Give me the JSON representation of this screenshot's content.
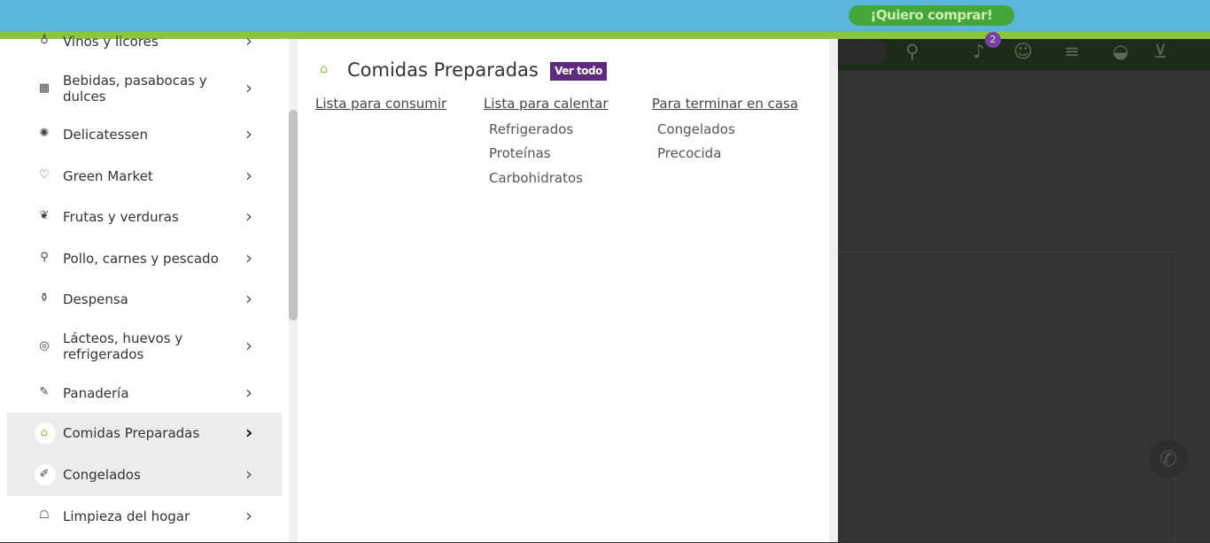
{
  "topbar": {
    "cta_label": "¡Quiero comprar!"
  },
  "header": {
    "notification_count": "2"
  },
  "sidebar": {
    "items": [
      {
        "label": "Vinos y licores",
        "icon": "wine-glass-icon"
      },
      {
        "label": "Bebidas, pasabocas y\ndulces",
        "icon": "snacks-icon"
      },
      {
        "label": "Delicatessen",
        "icon": "cookie-icon"
      },
      {
        "label": "Green Market",
        "icon": "heart-icon"
      },
      {
        "label": "Frutas y verduras",
        "icon": "fruit-icon"
      },
      {
        "label": "Pollo, carnes y pescado",
        "icon": "drumstick-icon"
      },
      {
        "label": "Despensa",
        "icon": "pantry-icon"
      },
      {
        "label": "Lácteos, huevos y\nrefrigerados",
        "icon": "egg-icon"
      },
      {
        "label": "Panadería",
        "icon": "bread-icon"
      },
      {
        "label": "Comidas Preparadas",
        "icon": "basket-icon"
      },
      {
        "label": "Congelados",
        "icon": "frozen-icon"
      },
      {
        "label": "Limpieza del hogar",
        "icon": "cleaning-icon"
      }
    ]
  },
  "panel": {
    "title": "Comidas Preparadas",
    "view_all": "Ver todo",
    "columns": [
      {
        "heading": "Lista para consumir",
        "items": []
      },
      {
        "heading": "Lista para calentar",
        "items": [
          "Refrigerados",
          "Proteínas",
          "Carbohidratos"
        ]
      },
      {
        "heading": "Para terminar en casa",
        "items": [
          "Congelados",
          "Precocida"
        ]
      }
    ]
  },
  "colors": {
    "topbar": "#5ab7d9",
    "accent_green": "#8cc63f",
    "cta": "#43a63a",
    "badge_purple": "#5e2a7e"
  }
}
